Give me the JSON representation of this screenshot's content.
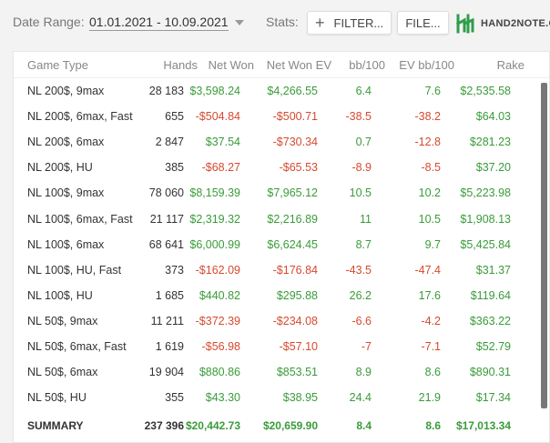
{
  "toolbar": {
    "date_range_label": "Date Range:",
    "date_range_value": "01.01.2021 - 10.09.2021",
    "stats_label": "Stats:",
    "filter_label": "FILTER...",
    "file_label": "FILE...",
    "logo_text": "HAND2NOTE.C"
  },
  "table": {
    "columns": [
      "Game Type",
      "Hands",
      "Net Won",
      "Net Won  EV",
      "bb/100",
      "EV bb/100",
      "Rake"
    ],
    "rows": [
      [
        "NL 200$, 9max",
        "28 183",
        "$3,598.24",
        "$4,266.55",
        "6.4",
        "7.6",
        "$2,535.58"
      ],
      [
        "NL 200$, 6max, Fast",
        "655",
        "-$504.84",
        "-$500.71",
        "-38.5",
        "-38.2",
        "$64.03"
      ],
      [
        "NL 200$, 6max",
        "2 847",
        "$37.54",
        "-$730.34",
        "0.7",
        "-12.8",
        "$281.23"
      ],
      [
        "NL 200$, HU",
        "385",
        "-$68.27",
        "-$65.53",
        "-8.9",
        "-8.5",
        "$37.20"
      ],
      [
        "NL 100$, 9max",
        "78 060",
        "$8,159.39",
        "$7,965.12",
        "10.5",
        "10.2",
        "$5,223.98"
      ],
      [
        "NL 100$, 6max, Fast",
        "21 117",
        "$2,319.32",
        "$2,216.89",
        "11",
        "10.5",
        "$1,908.13"
      ],
      [
        "NL 100$, 6max",
        "68 641",
        "$6,000.99",
        "$6,624.45",
        "8.7",
        "9.7",
        "$5,425.84"
      ],
      [
        "NL 100$, HU, Fast",
        "373",
        "-$162.09",
        "-$176.84",
        "-43.5",
        "-47.4",
        "$31.37"
      ],
      [
        "NL 100$, HU",
        "1 685",
        "$440.82",
        "$295.88",
        "26.2",
        "17.6",
        "$119.64"
      ],
      [
        "NL 50$, 9max",
        "11 211",
        "-$372.39",
        "-$234.08",
        "-6.6",
        "-4.2",
        "$363.22"
      ],
      [
        "NL 50$, 6max, Fast",
        "1 619",
        "-$56.98",
        "-$57.10",
        "-7",
        "-7.1",
        "$52.79"
      ],
      [
        "NL 50$, 6max",
        "19 904",
        "$880.86",
        "$853.51",
        "8.9",
        "8.6",
        "$890.31"
      ],
      [
        "NL 50$, HU",
        "355",
        "$43.30",
        "$38.95",
        "24.4",
        "21.9",
        "$17.34"
      ]
    ],
    "summary": [
      "SUMMARY",
      "237 396",
      "$20,442.73",
      "$20,659.90",
      "8.4",
      "8.6",
      "$17,013.34"
    ]
  },
  "colors": {
    "positive": "#3a9b3a",
    "negative": "#d64a2f",
    "logo": "#2e9e4a"
  }
}
